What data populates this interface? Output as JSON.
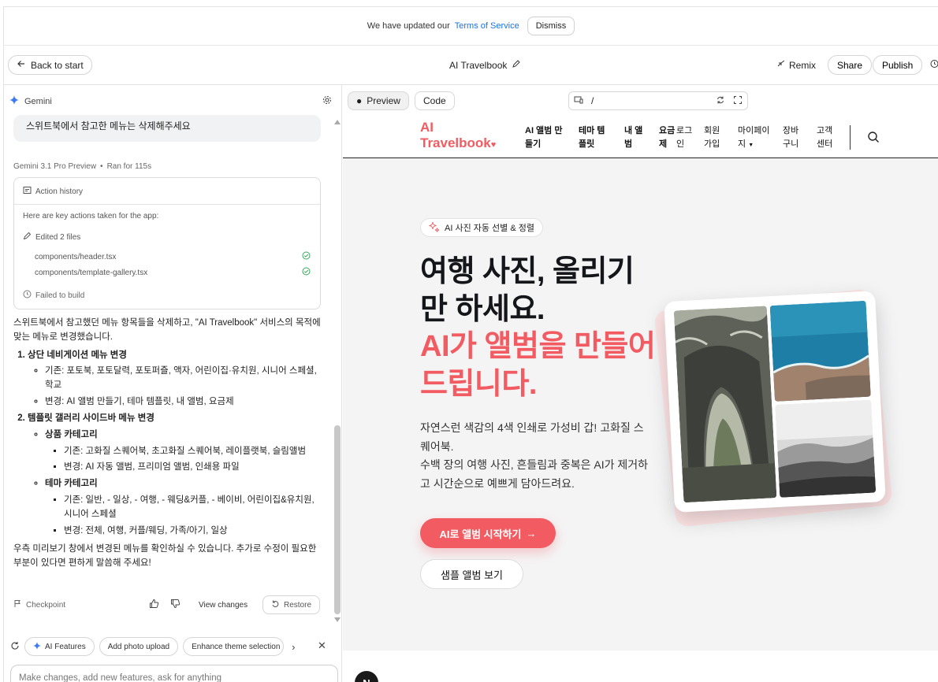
{
  "banner": {
    "text": "We have updated our",
    "link": "Terms of Service",
    "dismiss": "Dismiss"
  },
  "header": {
    "back": "Back to start",
    "title": "AI Travelbook",
    "remix": "Remix",
    "share": "Share",
    "publish": "Publish"
  },
  "chat": {
    "assistant_name": "Gemini",
    "user_message": "스위트북에서 참고한 메뉴는 삭제해주세요",
    "model": "Gemini 3.1 Pro Preview",
    "run_time": "Ran for 115s",
    "action_history": {
      "title": "Action history",
      "intro": "Here are key actions taken for the app:",
      "edited": "Edited 2 files",
      "files": [
        "components/header.tsx",
        "components/template-gallery.tsx"
      ],
      "failed": "Failed to build"
    },
    "response": {
      "intro": "스위트북에서 참고했던 메뉴 항목들을 삭제하고, \"AI Travelbook\" 서비스의 목적에 맞는 메뉴로 변경했습니다.",
      "item1_title": "상단 네비게이션 메뉴 변경",
      "item1_before": "기존: 포토북, 포토달력, 포토퍼즐, 액자, 어린이집·유치원, 시니어 스페셜, 학교",
      "item1_after": "변경: AI 앨범 만들기, 테마 템플릿, 내 앨범, 요금제",
      "item2_title": "템플릿 갤러리 사이드바 메뉴 변경",
      "cat1": "상품 카테고리",
      "cat1_before": "기존: 고화질 스퀘어북, 초고화질 스퀘어북, 레이플랫북, 슬림앨범",
      "cat1_after": "변경: AI 자동 앨범, 프리미엄 앨범, 인쇄용 파일",
      "cat2": "테마 카테고리",
      "cat2_before": "기존: 일반, - 일상, - 여행, - 웨딩&커플, - 베이비, 어린이집&유치원, 시니어 스페셜",
      "cat2_after": "변경: 전체, 여행, 커플/웨딩, 가족/아기, 일상",
      "closing": "우측 미리보기 창에서 변경된 메뉴를 확인하실 수 있습니다. 추가로 수정이 필요한 부분이 있다면 편하게 말씀해 주세요!"
    },
    "checkpoint": "Checkpoint",
    "view_changes": "View changes",
    "restore": "Restore",
    "chips": [
      "AI Features",
      "Add photo upload",
      "Enhance theme selection"
    ],
    "input_placeholder": "Make changes, add new features, ask for anything"
  },
  "preview": {
    "tab_preview": "Preview",
    "tab_code": "Code",
    "url_path": "/"
  },
  "site": {
    "logo_line1": "AI",
    "logo_line2": "Travelbook",
    "nav_main": [
      "AI 앨범 만들기",
      "테마 템플릿",
      "내 앨범",
      "요금제"
    ],
    "nav_util": [
      "로그인",
      "회원가입",
      "마이페이지",
      "장바구니",
      "고객센터"
    ],
    "badge": "AI 사진 자동 선별 & 정렬",
    "headline_1": "여행 사진, 올리기만 하세요.",
    "headline_2": "AI가 앨범을 만들어 드립니다.",
    "desc_1": "자연스런 색감의 4색 인쇄로 가성비 갑! 고화질 스퀘어북.",
    "desc_2": "수백 장의 여행 사진, 흔들림과 중복은 AI가 제거하고 시간순으로 예쁘게 담아드려요.",
    "cta_primary": "AI로 앨범 시작하기",
    "cta_secondary": "샘플 앨범 보기",
    "accent_color": "#f25b61"
  }
}
